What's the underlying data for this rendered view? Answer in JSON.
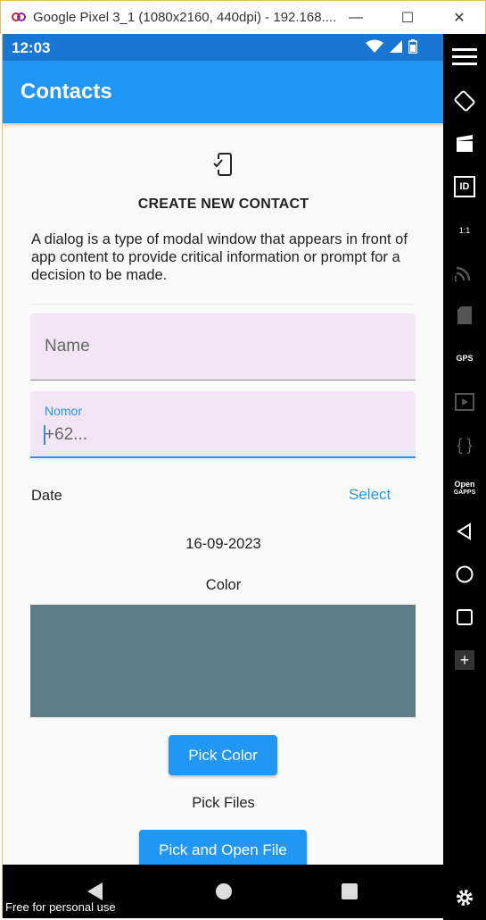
{
  "window": {
    "title": "Google Pixel 3_1 (1080x2160, 440dpi) - 192.168....",
    "minimize_glyph": "—",
    "maximize_glyph": "☐",
    "close_glyph": "✕"
  },
  "statusbar": {
    "time": "12:03",
    "icons": [
      "wifi-icon",
      "signal-icon",
      "battery-icon"
    ]
  },
  "appbar": {
    "title": "Contacts"
  },
  "dialog": {
    "icon": "phone-check-icon",
    "heading": "CREATE NEW CONTACT",
    "description": "A dialog is a type of modal window that appears in front of app content to provide critical information or prompt for a decision to be made."
  },
  "form": {
    "name_field": {
      "placeholder": "Name",
      "value": ""
    },
    "nomor_field": {
      "label": "Nomor",
      "placeholder": "+62...",
      "value": ""
    },
    "date_label": "Date",
    "select_label": "Select",
    "date_value": "16-09-2023",
    "color_label": "Color",
    "selected_color": "#607d8b",
    "pick_color_label": "Pick Color",
    "pick_files_label": "Pick Files",
    "pick_open_file_label": "Pick and Open File"
  },
  "navbar": {
    "icons": [
      "back-icon",
      "home-icon",
      "recents-icon"
    ]
  },
  "sidepanel": {
    "icons": [
      "menu-icon",
      "rotate-icon",
      "screen-record-icon",
      "id-icon",
      "resize-icon",
      "cast-icon",
      "sim-icon",
      "gps-icon",
      "media-icon",
      "code-icon",
      "opengapps-icon",
      "back-icon",
      "home-icon",
      "overview-icon",
      "add-icon",
      "settings-icon"
    ],
    "gps_text": "GPS",
    "id_text": "ID",
    "open_text": "Open",
    "gapps_text": "GAPPS",
    "resize_text": "1:1"
  },
  "watermark": "Free for personal use",
  "colors": {
    "accent": "#2196f3",
    "statusbar": "#1976d2",
    "field_bg": "#f3e5f5"
  }
}
